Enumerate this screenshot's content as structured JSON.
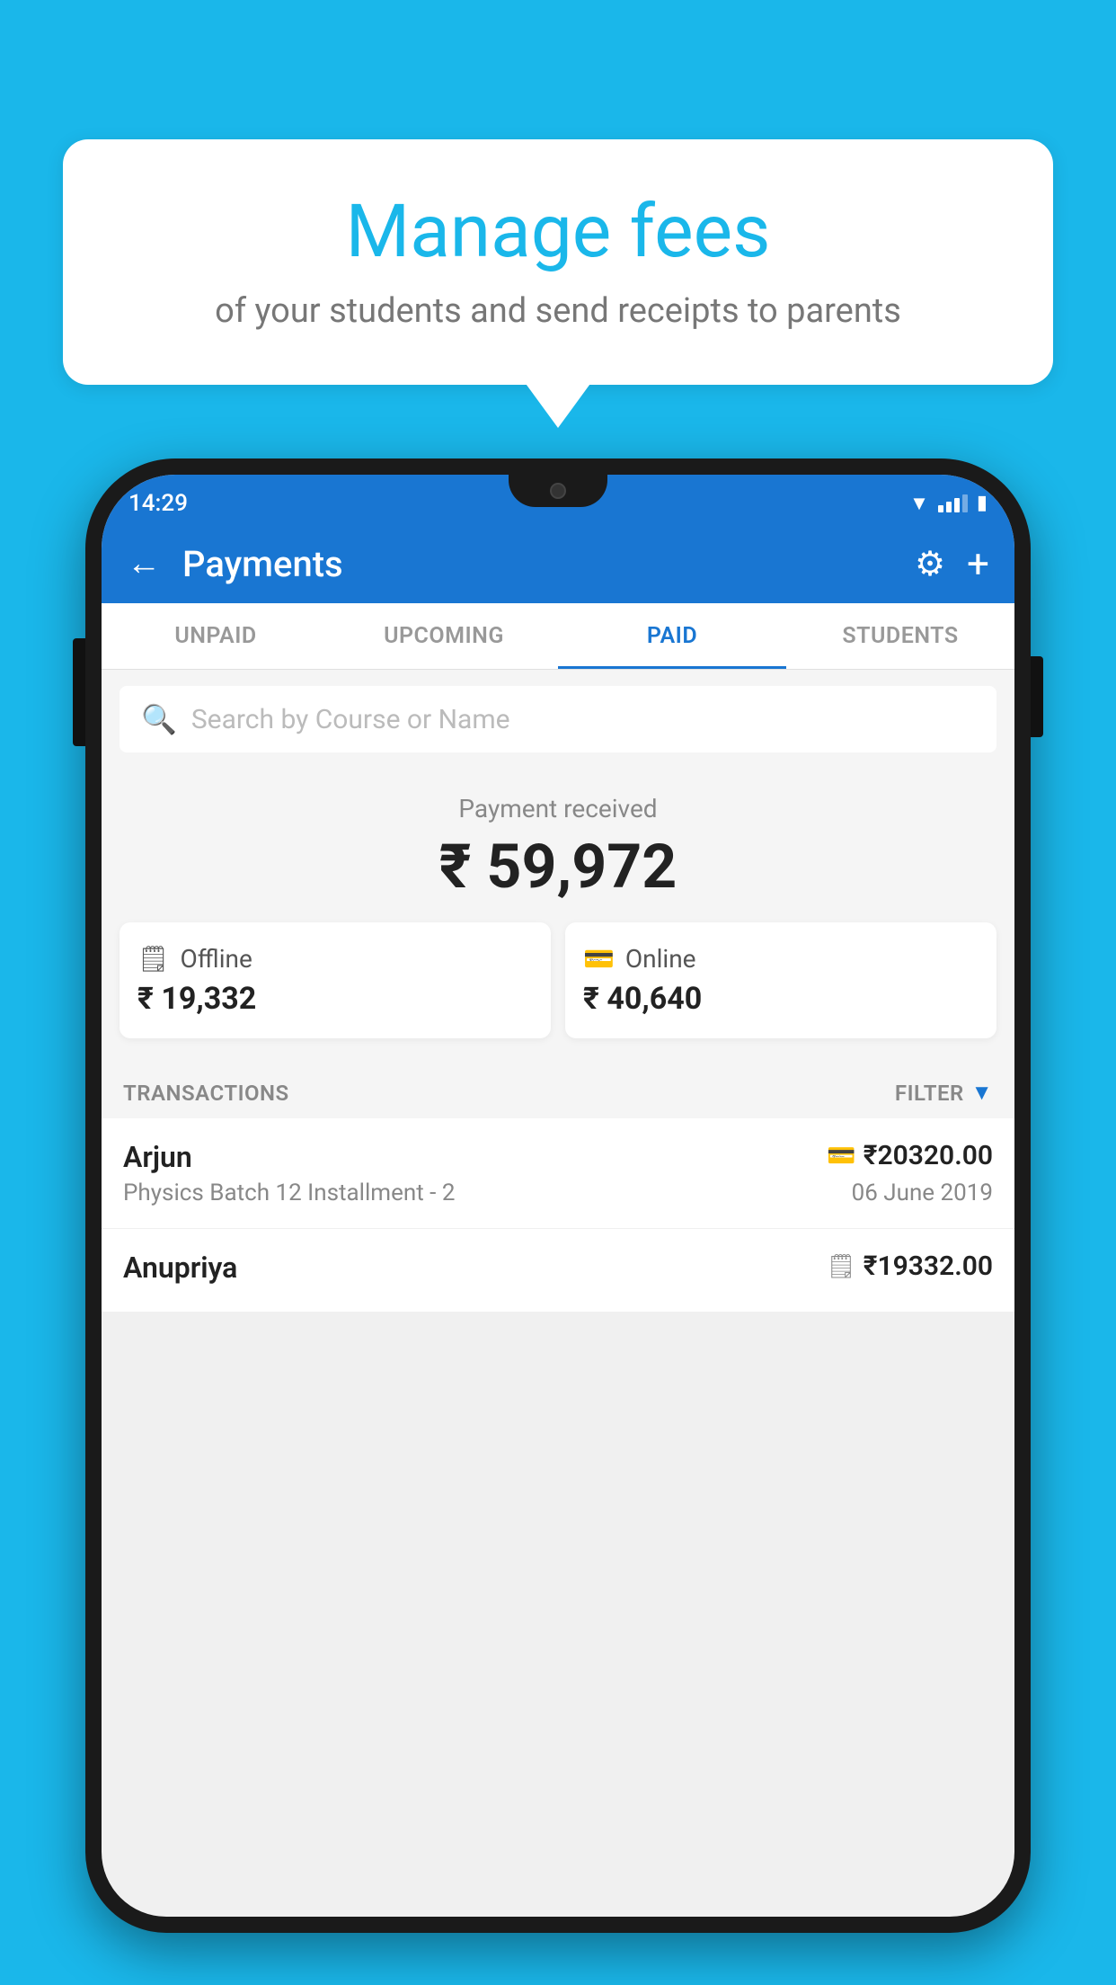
{
  "background_color": "#1ab7ea",
  "speech_bubble": {
    "title": "Manage fees",
    "subtitle": "of your students and send receipts to parents"
  },
  "status_bar": {
    "time": "14:29"
  },
  "header": {
    "title": "Payments",
    "back_label": "←",
    "gear_label": "⚙",
    "plus_label": "+"
  },
  "tabs": [
    {
      "label": "UNPAID",
      "active": false
    },
    {
      "label": "UPCOMING",
      "active": false
    },
    {
      "label": "PAID",
      "active": true
    },
    {
      "label": "STUDENTS",
      "active": false
    }
  ],
  "search": {
    "placeholder": "Search by Course or Name"
  },
  "payment_summary": {
    "label": "Payment received",
    "amount": "₹ 59,972",
    "offline_label": "Offline",
    "offline_amount": "₹ 19,332",
    "online_label": "Online",
    "online_amount": "₹ 40,640"
  },
  "transactions_section": {
    "label": "TRANSACTIONS",
    "filter_label": "FILTER"
  },
  "transactions": [
    {
      "name": "Arjun",
      "description": "Physics Batch 12 Installment - 2",
      "amount": "₹20320.00",
      "date": "06 June 2019",
      "type": "online"
    },
    {
      "name": "Anupriya",
      "description": "",
      "amount": "₹19332.00",
      "date": "",
      "type": "offline"
    }
  ]
}
